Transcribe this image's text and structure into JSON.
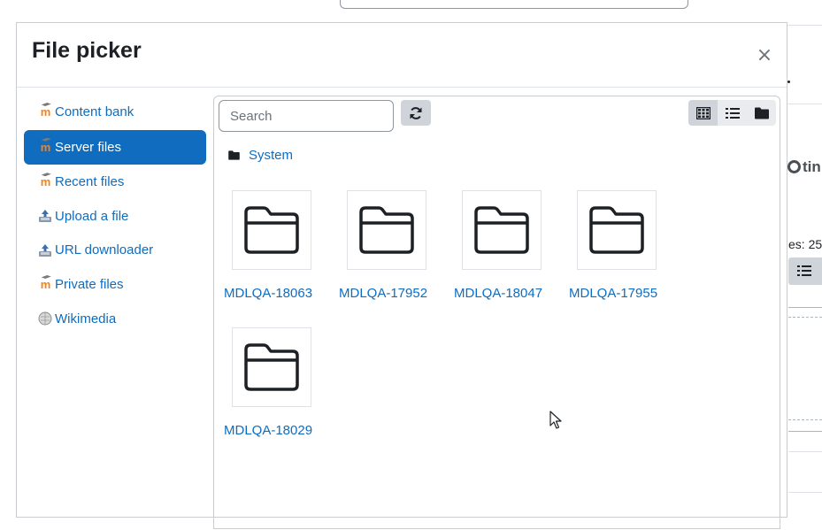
{
  "background": {
    "tiny_text": "tin",
    "files_text": "es: 25"
  },
  "modal": {
    "title": "File picker",
    "close_symbol": "×"
  },
  "sidebar": {
    "items": [
      {
        "label": "Content bank",
        "icon": "moodle-icon",
        "active": false
      },
      {
        "label": "Server files",
        "icon": "moodle-icon",
        "active": true
      },
      {
        "label": "Recent files",
        "icon": "moodle-icon",
        "active": false
      },
      {
        "label": "Upload a file",
        "icon": "upload-icon",
        "active": false
      },
      {
        "label": "URL downloader",
        "icon": "url-download-icon",
        "active": false
      },
      {
        "label": "Private files",
        "icon": "moodle-icon",
        "active": false
      },
      {
        "label": "Wikimedia",
        "icon": "wikimedia-globe-icon",
        "active": false
      }
    ]
  },
  "toolbar": {
    "search_placeholder": "Search",
    "refresh_icon": "refresh-icon",
    "view_modes": [
      "icons",
      "list",
      "tree"
    ],
    "active_view": "icons"
  },
  "path": {
    "label": "System",
    "icon": "folder-icon"
  },
  "files": [
    {
      "name": "MDLQA-18063",
      "type": "folder"
    },
    {
      "name": "MDLQA-17952",
      "type": "folder"
    },
    {
      "name": "MDLQA-18047",
      "type": "folder"
    },
    {
      "name": "MDLQA-17955",
      "type": "folder"
    },
    {
      "name": "MDLQA-18029",
      "type": "folder"
    }
  ],
  "colors": {
    "link": "#0f6cbf",
    "active_bg": "#0f6cbf",
    "moodle_orange": "#f98012"
  }
}
